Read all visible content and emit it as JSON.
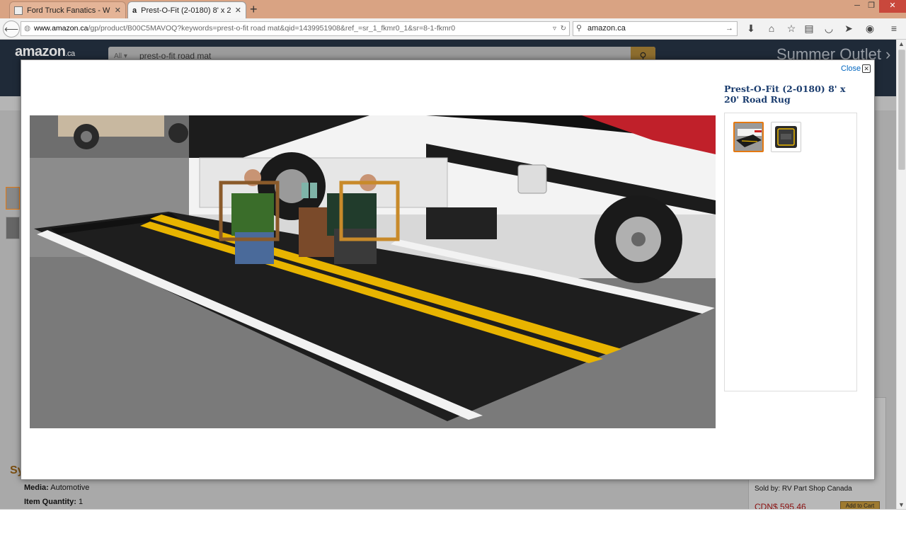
{
  "browser": {
    "tabs": [
      {
        "title": "Ford Truck Fanatics - Who..."
      },
      {
        "title": "Prest-O-Fit (2-0180) 8' x 20..."
      }
    ],
    "url_host": "www.amazon.ca",
    "url_path": "/gp/product/B00C5MAVOQ?keywords=prest-o-fit road mat&qid=1439951908&ref_=sr_1_fkmr0_1&sr=8-1-fkmr0",
    "search_engine_text": "amazon.ca"
  },
  "amazon": {
    "logo": "amazon",
    "logo_suffix": ".ca",
    "search_category": "All",
    "search_query": "prest-o-fit road mat",
    "banner": "Summer Outlet"
  },
  "modal": {
    "close_label": "Close",
    "product_title": "Prest-O-Fit (2-0180) 8' x 20' Road Rug"
  },
  "page_details": {
    "media_label": "Media:",
    "media_value": "Automotive",
    "quantity_label": "Item Quantity:",
    "quantity_value": "1",
    "sold_by_label": "Sold by:",
    "sold_by_value": "RV Part Shop Canada",
    "price": "CDN$ 595.46",
    "add_to_cart": "Add to Cart"
  }
}
